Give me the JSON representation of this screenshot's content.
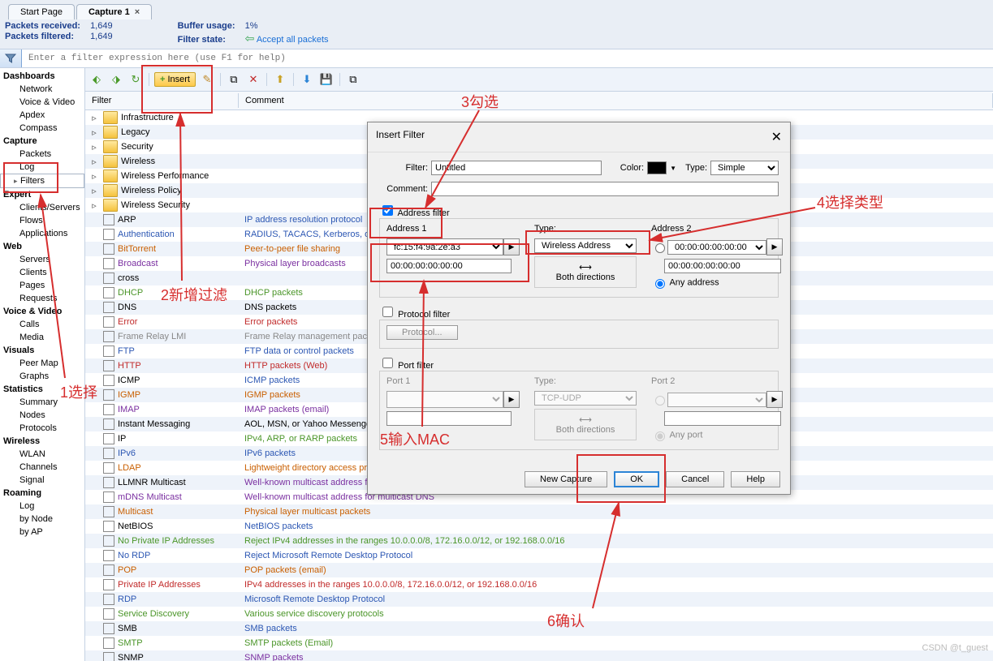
{
  "tabs": {
    "start": "Start Page",
    "cap": "Capture 1"
  },
  "stats": {
    "received_lbl": "Packets received:",
    "received": "1,649",
    "filtered_lbl": "Packets filtered:",
    "filtered": "1,649",
    "buffer_lbl": "Buffer usage:",
    "buffer": "1%",
    "state_lbl": "Filter state:",
    "state": "Accept all packets"
  },
  "filterbar": {
    "placeholder": "Enter a filter expression here (use F1 for help)"
  },
  "nav": [
    {
      "h": "Dashboards",
      "items": [
        "Network",
        "Voice & Video",
        "Apdex",
        "Compass"
      ]
    },
    {
      "h": "Capture",
      "items": [
        "Packets",
        "Log",
        "Filters"
      ]
    },
    {
      "h": "Expert",
      "items": [
        "Clients/Servers",
        "Flows",
        "Applications"
      ]
    },
    {
      "h": "Web",
      "items": [
        "Servers",
        "Clients",
        "Pages",
        "Requests"
      ]
    },
    {
      "h": "Voice & Video",
      "items": [
        "Calls",
        "Media"
      ]
    },
    {
      "h": "Visuals",
      "items": [
        "Peer Map",
        "Graphs"
      ]
    },
    {
      "h": "Statistics",
      "items": [
        "Summary",
        "Nodes",
        "Protocols"
      ]
    },
    {
      "h": "Wireless",
      "items": [
        "WLAN",
        "Channels",
        "Signal"
      ]
    },
    {
      "h": "Roaming",
      "items": [
        "Log",
        "by Node",
        "by AP"
      ]
    }
  ],
  "toolbar": {
    "insert": "Insert"
  },
  "cols": {
    "filter": "Filter",
    "comment": "Comment"
  },
  "folders": [
    "Infrastructure",
    "Legacy",
    "Security",
    "Wireless",
    "Wireless Performance",
    "Wireless Policy",
    "Wireless Security"
  ],
  "filters": [
    {
      "n": "ARP",
      "c": "IP address resolution protocol",
      "cc": "c-blue"
    },
    {
      "n": "Authentication",
      "c": "RADIUS, TACACS, Kerberos, or 802.1X packets",
      "cc": "c-blue",
      "nc": "c-blue"
    },
    {
      "n": "BitTorrent",
      "c": "Peer-to-peer file sharing",
      "cc": "c-orange",
      "nc": "c-orange"
    },
    {
      "n": "Broadcast",
      "c": "Physical layer broadcasts",
      "cc": "c-purple",
      "nc": "c-purple"
    },
    {
      "n": "cross",
      "c": ""
    },
    {
      "n": "DHCP",
      "c": "DHCP packets",
      "cc": "c-green",
      "nc": "c-green"
    },
    {
      "n": "DNS",
      "c": "DNS packets"
    },
    {
      "n": "Error",
      "c": "Error packets",
      "cc": "c-red",
      "nc": "c-red"
    },
    {
      "n": "Frame Relay LMI",
      "c": "Frame Relay management packets",
      "cc": "dis",
      "nc": "dis"
    },
    {
      "n": "FTP",
      "c": "FTP data or control packets",
      "cc": "c-blue",
      "nc": "c-blue"
    },
    {
      "n": "HTTP",
      "c": "HTTP packets (Web)",
      "cc": "c-red",
      "nc": "c-red"
    },
    {
      "n": "ICMP",
      "c": "ICMP packets",
      "cc": "c-blue"
    },
    {
      "n": "IGMP",
      "c": "IGMP packets",
      "cc": "c-orange",
      "nc": "c-orange"
    },
    {
      "n": "IMAP",
      "c": "IMAP packets (email)",
      "cc": "c-purple",
      "nc": "c-purple"
    },
    {
      "n": "Instant Messaging",
      "c": "AOL, MSN, or Yahoo Messenger packets"
    },
    {
      "n": "IP",
      "c": "IPv4, ARP, or RARP packets",
      "cc": "c-green"
    },
    {
      "n": "IPv6",
      "c": "IPv6 packets",
      "cc": "c-blue",
      "nc": "c-blue"
    },
    {
      "n": "LDAP",
      "c": "Lightweight directory access protocol",
      "cc": "c-orange",
      "nc": "c-orange"
    },
    {
      "n": "LLMNR Multicast",
      "c": "Well-known multicast address for Link-Local Multicast Name Resolution",
      "cc": "c-purple"
    },
    {
      "n": "mDNS Multicast",
      "c": "Well-known multicast address for multicast DNS",
      "cc": "c-purple",
      "nc": "c-purple"
    },
    {
      "n": "Multicast",
      "c": "Physical layer multicast packets",
      "cc": "c-orange",
      "nc": "c-orange"
    },
    {
      "n": "NetBIOS",
      "c": "NetBIOS packets",
      "cc": "c-blue"
    },
    {
      "n": "No Private IP Addresses",
      "c": "Reject IPv4 addresses in the ranges 10.0.0.0/8, 172.16.0.0/12, or 192.168.0.0/16",
      "nc": "c-green",
      "cc": "c-green"
    },
    {
      "n": "No RDP",
      "c": "Reject Microsoft Remote Desktop Protocol",
      "cc": "c-blue",
      "nc": "c-blue"
    },
    {
      "n": "POP",
      "c": "POP packets (email)",
      "cc": "c-orange",
      "nc": "c-orange"
    },
    {
      "n": "Private IP Addresses",
      "c": "IPv4 addresses in the ranges 10.0.0.0/8, 172.16.0.0/12, or 192.168.0.0/16",
      "cc": "c-red",
      "nc": "c-red"
    },
    {
      "n": "RDP",
      "c": "Microsoft Remote Desktop Protocol",
      "cc": "c-blue",
      "nc": "c-blue"
    },
    {
      "n": "Service Discovery",
      "c": "Various service discovery protocols",
      "cc": "c-green",
      "nc": "c-green"
    },
    {
      "n": "SMB",
      "c": "SMB packets",
      "cc": "c-blue"
    },
    {
      "n": "SMTP",
      "c": "SMTP packets (Email)",
      "cc": "c-green",
      "nc": "c-green"
    },
    {
      "n": "SNMP",
      "c": "SNMP packets",
      "cc": "c-purple"
    }
  ],
  "dlg": {
    "title": "Insert Filter",
    "filter_lbl": "Filter:",
    "filter_val": "Untitled",
    "color_lbl": "Color:",
    "type_lbl": "Type:",
    "type_val": "Simple",
    "comment_lbl": "Comment:",
    "addr_filter": "Address filter",
    "addr1": "Address 1",
    "addr2": "Address 2",
    "type2_lbl": "Type:",
    "type2_val": "Wireless Address",
    "mac": "fc:15:f4:9a:2e:a3",
    "mac2": "00:00:00:00:00:00",
    "both": "Both directions",
    "anyaddr": "Any address",
    "proto_filter": "Protocol filter",
    "proto_btn": "Protocol...",
    "port_filter": "Port filter",
    "port1": "Port 1",
    "port2": "Port 2",
    "ptype": "Type:",
    "ptype_val": "TCP-UDP",
    "anyport": "Any port",
    "newcap": "New Capture",
    "ok": "OK",
    "cancel": "Cancel",
    "help": "Help"
  },
  "ann": {
    "a1": "1选择",
    "a2": "2新增过滤",
    "a3": "3勾选",
    "a4": "4选择类型",
    "a5": "5输入MAC",
    "a6": "6确认"
  },
  "watermark": "CSDN @t_guest"
}
